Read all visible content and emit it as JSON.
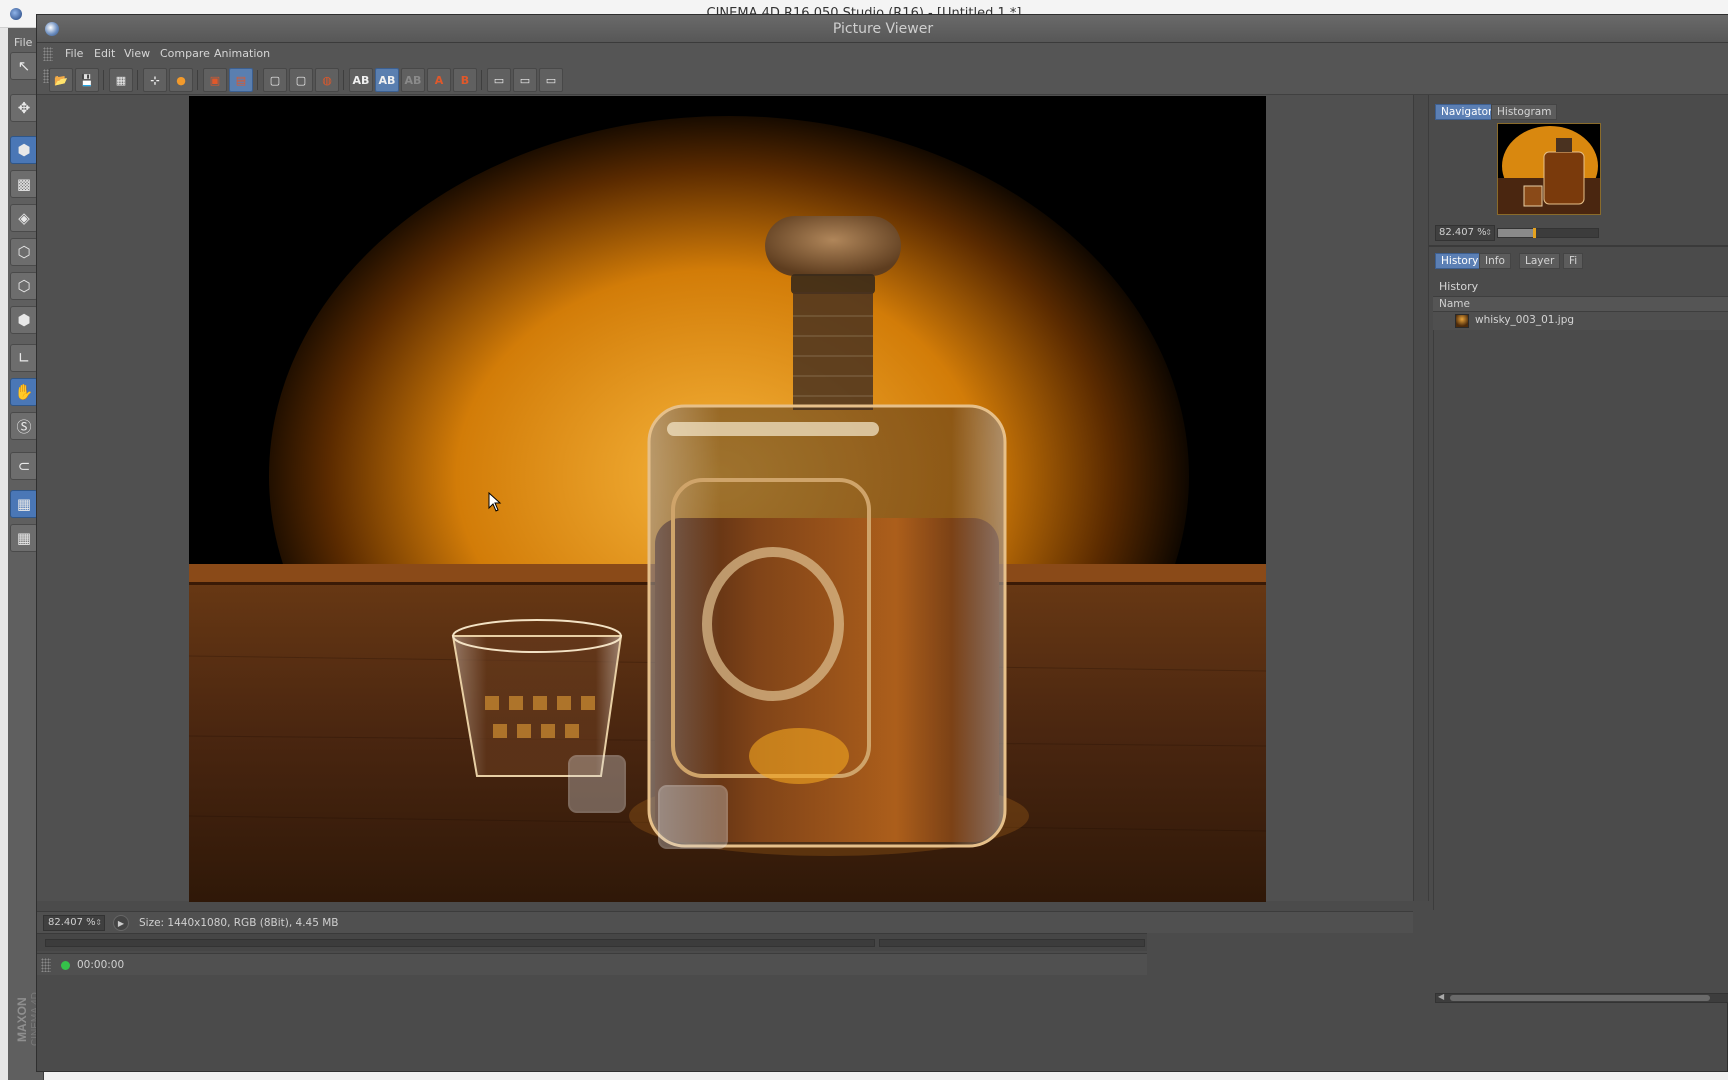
{
  "outer_window": {
    "title": "CINEMA 4D R16.050 Studio (R16) - [Untitled 1 *]",
    "menu_file": "File"
  },
  "picture_viewer": {
    "title": "Picture Viewer",
    "menu": [
      "File",
      "Edit",
      "View",
      "Compare",
      "Animation"
    ],
    "toolbar_icons": [
      "open-icon",
      "save-icon",
      "grid-icon",
      "regions-icon",
      "user-icon",
      "render-red-icon",
      "render-stack-icon",
      "frame-icon",
      "frame-play-icon",
      "frame-render-icon",
      "ab-icon",
      "ab-active-icon",
      "ab-disabled-icon",
      "set-a-icon",
      "set-b-icon",
      "layout-1-icon",
      "layout-2-icon",
      "layout-3-icon"
    ],
    "toolbar_glyphs": [
      "📂",
      "💾",
      "▦",
      "⊹",
      "●",
      "▣",
      "▤",
      "▢",
      "▢",
      "◍",
      "AB",
      "AB",
      "AB",
      "A",
      "B",
      "▭",
      "▭",
      "▭"
    ],
    "status": {
      "zoom": "82.407 %",
      "size_text": "Size: 1440x1080, RGB (8Bit), 4.45 MB",
      "time": "00:00:00"
    }
  },
  "right_panel": {
    "top_tabs": [
      "Navigator",
      "Histogram"
    ],
    "nav_zoom": "82.407 %",
    "nav_slider_fraction": 0.35,
    "bottom_tabs": [
      "History",
      "Info",
      "Layer",
      "Fi"
    ],
    "heading": "History",
    "column": "Name",
    "items": [
      {
        "name": "whisky_003_01.jpg"
      }
    ]
  },
  "colors": {
    "accent": "#5b7fb4",
    "status_green": "#35c24a",
    "panel": "#4b4b4b"
  }
}
